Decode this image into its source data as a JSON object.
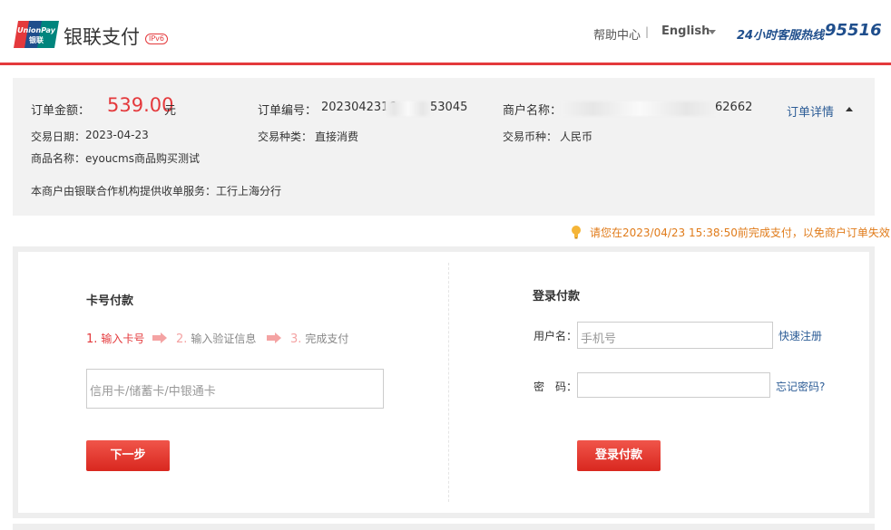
{
  "header": {
    "logo_text": "UnionPay 银联",
    "title": "银联支付",
    "ipv6_badge": "IPv6",
    "help_link": "帮助中心",
    "separator": "|",
    "language": "English",
    "hotline_label": "24小时客服热线",
    "hotline_number": "95516"
  },
  "order": {
    "amount_label": "订单金额：",
    "amount_value": "539.00",
    "amount_unit": "元",
    "order_no_label": "订单编号：",
    "order_no_start": "2023042316",
    "order_no_end": "53045",
    "merchant_label": "商户名称：",
    "merchant_end": "62662",
    "detail_link": "订单详情",
    "date_label": "交易日期：",
    "date_value": "2023-04-23",
    "type_label": "交易种类：",
    "type_value": "直接消费",
    "currency_label": "交易币种：",
    "currency_value": "人民币",
    "product_label": "商品名称：",
    "product_value": "eyoucms商品购买测试",
    "acquirer_note": "本商户由银联合作机构提供收单服务：工行上海分行"
  },
  "notice": "请您在2023/04/23 15:38:50前完成支付，以免商户订单失效",
  "card_pay": {
    "title": "卡号付款",
    "steps": [
      {
        "num": "1.",
        "label": "输入卡号"
      },
      {
        "num": "2.",
        "label": "输入验证信息"
      },
      {
        "num": "3.",
        "label": "完成支付"
      }
    ],
    "card_placeholder": "信用卡/储蓄卡/中银通卡",
    "next_button": "下一步"
  },
  "login_pay": {
    "title": "登录付款",
    "username_label": "用户名：",
    "username_placeholder": "手机号",
    "register_link": "快速注册",
    "password_label": "密　码：",
    "forgot_link": "忘记密码?",
    "login_button": "登录付款"
  },
  "colors": {
    "brand_red": "#e4393c",
    "link_blue": "#2c5c96",
    "notice_orange": "#e07b1a"
  }
}
